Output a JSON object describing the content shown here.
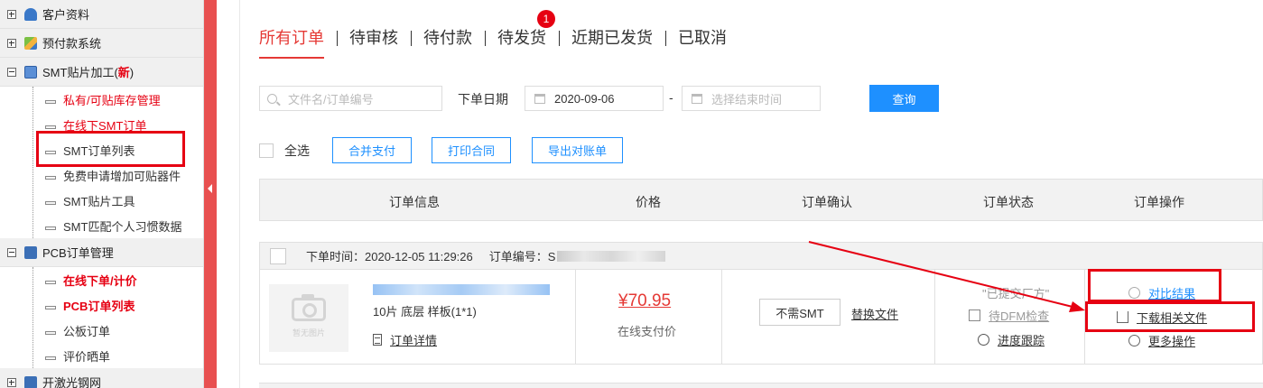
{
  "sidebar": {
    "groups": [
      {
        "label": "客户资料",
        "icon": "user-icon",
        "state": "collapsed"
      },
      {
        "label": "预付款系统",
        "icon": "layers-icon",
        "state": "collapsed"
      },
      {
        "label": "SMT贴片加工(",
        "new_tag": "新",
        "close": ")",
        "icon": "chip-icon",
        "state": "expanded"
      },
      {
        "label": "PCB订单管理",
        "icon": "pcb-icon",
        "state": "expanded"
      },
      {
        "label": "开激光钢网",
        "icon": "stencil-icon",
        "state": "collapsed"
      }
    ],
    "smt_items": [
      "私有/可贴库存管理",
      "在线下SMT订单",
      "SMT订单列表",
      "免费申请增加可贴器件",
      "SMT贴片工具",
      "SMT匹配个人习惯数据"
    ],
    "pcb_items": [
      "在线下单/计价",
      "PCB订单列表",
      "公板订单",
      "评价晒单"
    ]
  },
  "tabs": [
    {
      "label": "所有订单",
      "active": true
    },
    {
      "label": "待审核"
    },
    {
      "label": "待付款"
    },
    {
      "label": "待发货",
      "badge": "1"
    },
    {
      "label": "近期已发货"
    },
    {
      "label": "已取消"
    }
  ],
  "filters": {
    "search_placeholder": "文件名/订单编号",
    "date_label": "下单日期",
    "start_date": "2020-09-06",
    "separator": "-",
    "end_placeholder": "选择结束时间",
    "query_button": "查询"
  },
  "actions": {
    "select_all": "全选",
    "merge_pay": "合并支付",
    "print_contract": "打印合同",
    "export_statement": "导出对账单"
  },
  "table_headers": [
    "订单信息",
    "价格",
    "订单确认",
    "订单状态",
    "订单操作"
  ],
  "order": {
    "time_label": "下单时间：2020-12-05 11:29:26",
    "number_label": "订单编号：S",
    "thumb_text": "暂无图片",
    "spec": "10片  底层  样板(1*1)",
    "detail_link": "订单详情",
    "price": "¥70.95",
    "pay_type": "在线支付价",
    "no_smt": "不需SMT",
    "replace_file": "替换文件",
    "status": "\"已提交厂方\"",
    "dfm": "待DFM检查",
    "progress": "进度跟踪",
    "compare": "对比结果",
    "download": "下载相关文件",
    "more": "更多操作"
  },
  "colors": {
    "accent_red": "#e53935",
    "highlight_red": "#e60012",
    "link_blue": "#1e90ff",
    "handle_red": "#e85050"
  }
}
